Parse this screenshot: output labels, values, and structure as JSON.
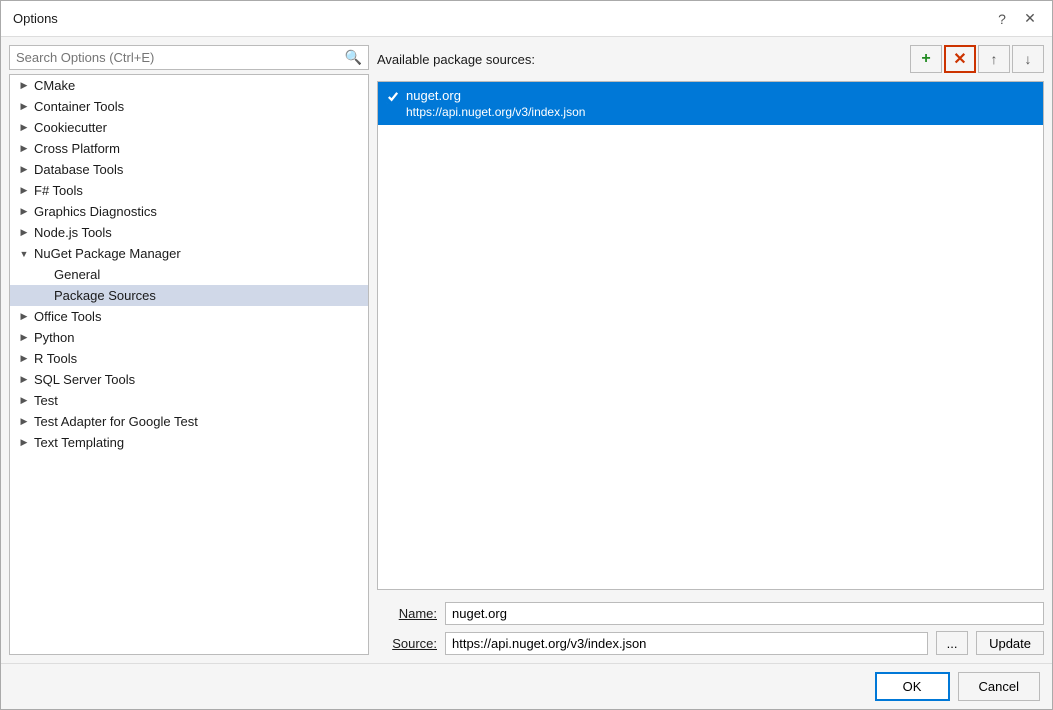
{
  "dialog": {
    "title": "Options",
    "help_label": "?",
    "close_label": "✕"
  },
  "search": {
    "placeholder": "Search Options (Ctrl+E)"
  },
  "tree": {
    "items": [
      {
        "id": "cmake",
        "label": "CMake",
        "level": 0,
        "expanded": false,
        "selected": false
      },
      {
        "id": "container-tools",
        "label": "Container Tools",
        "level": 0,
        "expanded": false,
        "selected": false
      },
      {
        "id": "cookiecutter",
        "label": "Cookiecutter",
        "level": 0,
        "expanded": false,
        "selected": false
      },
      {
        "id": "cross-platform",
        "label": "Cross Platform",
        "level": 0,
        "expanded": false,
        "selected": false
      },
      {
        "id": "database-tools",
        "label": "Database Tools",
        "level": 0,
        "expanded": false,
        "selected": false
      },
      {
        "id": "fsharp-tools",
        "label": "F# Tools",
        "level": 0,
        "expanded": false,
        "selected": false
      },
      {
        "id": "graphics-diagnostics",
        "label": "Graphics Diagnostics",
        "level": 0,
        "expanded": false,
        "selected": false
      },
      {
        "id": "nodejs-tools",
        "label": "Node.js Tools",
        "level": 0,
        "expanded": false,
        "selected": false
      },
      {
        "id": "nuget-package-manager",
        "label": "NuGet Package Manager",
        "level": 0,
        "expanded": true,
        "selected": false
      },
      {
        "id": "general",
        "label": "General",
        "level": 1,
        "expanded": false,
        "selected": false
      },
      {
        "id": "package-sources",
        "label": "Package Sources",
        "level": 1,
        "expanded": false,
        "selected": true
      },
      {
        "id": "office-tools",
        "label": "Office Tools",
        "level": 0,
        "expanded": false,
        "selected": false
      },
      {
        "id": "python",
        "label": "Python",
        "level": 0,
        "expanded": false,
        "selected": false
      },
      {
        "id": "r-tools",
        "label": "R Tools",
        "level": 0,
        "expanded": false,
        "selected": false
      },
      {
        "id": "sql-server-tools",
        "label": "SQL Server Tools",
        "level": 0,
        "expanded": false,
        "selected": false
      },
      {
        "id": "test",
        "label": "Test",
        "level": 0,
        "expanded": false,
        "selected": false
      },
      {
        "id": "test-adapter-google-test",
        "label": "Test Adapter for Google Test",
        "level": 0,
        "expanded": false,
        "selected": false
      },
      {
        "id": "text-templating",
        "label": "Text Templating",
        "level": 0,
        "expanded": false,
        "selected": false
      }
    ]
  },
  "right_panel": {
    "header_label": "Available package sources:",
    "buttons": {
      "add_label": "+",
      "remove_label": "✕",
      "up_label": "↑",
      "down_label": "↓"
    },
    "sources": [
      {
        "id": "nuget-org",
        "checked": true,
        "name": "nuget.org",
        "url": "https://api.nuget.org/v3/index.json",
        "selected": true
      }
    ],
    "form": {
      "name_label": "Name:",
      "source_label": "Source:",
      "name_value": "nuget.org",
      "source_value": "https://api.nuget.org/v3/index.json",
      "browse_label": "...",
      "update_label": "Update"
    }
  },
  "footer": {
    "ok_label": "OK",
    "cancel_label": "Cancel"
  }
}
